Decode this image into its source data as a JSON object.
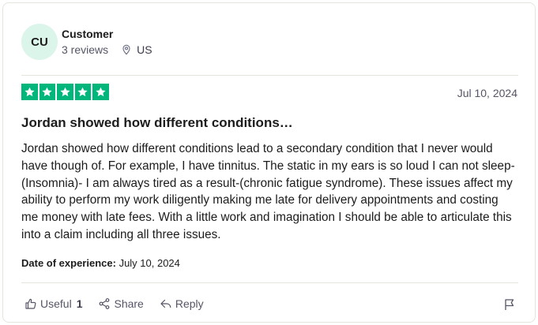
{
  "review": {
    "consumer": {
      "initials": "CU",
      "name": "Customer",
      "reviews_count": "3 reviews",
      "location": "US"
    },
    "rating": 5,
    "date": "Jul 10, 2024",
    "title": "Jordan showed how different conditions…",
    "body": "Jordan showed how different conditions lead to a secondary condition that I never would have though of. For example, I have tinnitus. The static in my ears is so loud I can not sleep- (Insomnia)- I am always tired as a result-(chronic fatigue syndrome). These issues affect my ability to perform my work diligently making me late for delivery appointments and costing me money with late fees. With a little work and imagination I should be able to articulate this into a claim including all three issues.",
    "experience_label": "Date of experience:",
    "experience_date": "July 10, 2024"
  },
  "actions": {
    "useful_label": "Useful",
    "useful_count": "1",
    "share_label": "Share",
    "reply_label": "Reply"
  },
  "colors": {
    "star_green": "#00b67a",
    "avatar_bg": "#dcf5ea",
    "muted_text": "#6c6c85"
  },
  "icons": [
    "location-pin-icon",
    "star-icon",
    "thumbs-up-icon",
    "share-icon",
    "reply-icon",
    "flag-icon"
  ]
}
